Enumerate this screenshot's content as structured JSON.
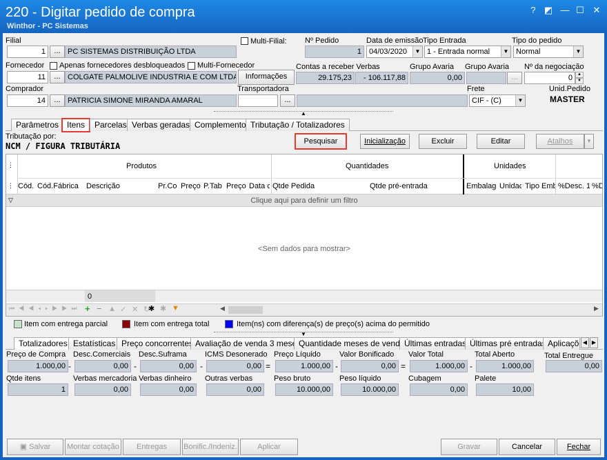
{
  "window": {
    "title": "220 - Digitar pedido de compra",
    "subtitle": "Winthor - PC Sistemas"
  },
  "header": {
    "filial_label": "Filial",
    "filial_value": "1",
    "filial_name": "PC SISTEMAS DISTRIBUIÇÃO LTDA",
    "multi_filial": "Multi-Filial:",
    "num_pedido_label": "Nº Pedido",
    "num_pedido_value": "1",
    "data_emissao_label": "Data de emissão",
    "data_emissao_value": "04/03/2020",
    "tipo_entrada_label": "Tipo Entrada",
    "tipo_entrada_value": "1 - Entrada normal",
    "tipo_pedido_label": "Tipo do pedido",
    "tipo_pedido_value": "Normal",
    "fornecedor_label": "Fornecedor",
    "fornecedores_desbloq": "Apenas fornecedores desbloqueados",
    "multi_fornecedor": "Multi-Fornecedor",
    "fornecedor_value": "11",
    "fornecedor_name": "COLGATE PALMOLIVE INDUSTRIA  E COM LTDA",
    "informacoes": "Informações",
    "contas_label": "Contas a receber Verbas",
    "contas_value1": "29.175,23",
    "contas_value2": "- 106.117,88",
    "grupo_avaria_label": "Grupo Avaria",
    "grupo_avaria_value": "0,00",
    "grupo_avaria2_label": "Grupo Avaria",
    "num_negociacao_label": "Nº da negociação",
    "num_negociacao_value": "0",
    "comprador_label": "Comprador",
    "comprador_value": "14",
    "comprador_name": "PATRICIA SIMONE MIRANDA AMARAL",
    "transportadora_label": "Transportadora",
    "frete_label": "Frete",
    "frete_value": "CIF - (C)",
    "unid_pedido_label": "Unid.Pedido",
    "unid_pedido_value": "MASTER",
    "ellipsis": "...",
    "spin_up": "▲",
    "spin_down": "▼"
  },
  "tabs": [
    "Parâmetros",
    "Itens",
    "Parcelas",
    "Verbas geradas",
    "Complemento",
    "Tributação / Totalizadores"
  ],
  "toolbar": {
    "tributacao_label": "Tributação por:",
    "tributacao_value": "NCM / FIGURA TRIBUTÁRIA",
    "pesquisar": "Pesquisar",
    "inicializacao": "Inicialização",
    "excluir": "Excluir",
    "editar": "Editar",
    "atalhos": "Atalhos"
  },
  "grid": {
    "band_produtos": "Produtos",
    "band_quantidades": "Quantidades",
    "band_unidades": "Unidades",
    "columns": [
      "Cód.",
      "Cód.Fábrica",
      "Descrição",
      "Pr.Co",
      "Preço",
      "P.Tab",
      "Preço",
      "Data c",
      "Qtde Pedida",
      "Qtde pré-entrada",
      "Embalage",
      "Unidac",
      "Tipo Emb",
      "%Desc. 1",
      "%D"
    ],
    "filter_text": "Clique aqui para definir um filtro",
    "empty_text": "<Sem dados para mostrar>",
    "footer_count": "0"
  },
  "legend": [
    "Item com entrega parcial",
    "Item com entrega total",
    "Item(ns) com diferença(s) de preço(s) acima do permitido"
  ],
  "legend_colors": [
    "#c8e0c8",
    "#8b0000",
    "#0000ff"
  ],
  "bottom_tabs": [
    "Totalizadores",
    "Estatísticas",
    "Preço concorrentes",
    "Avaliação de venda 3 meses",
    "Quantidade meses de venda",
    "Últimas entradas",
    "Últimas pré entradas",
    "Aplicaçõe"
  ],
  "totals_row1": [
    {
      "label": "Preço de Compra",
      "value": "1.000,00"
    },
    {
      "label": "Desc.Comerciais",
      "value": "0,00"
    },
    {
      "label": "Desc.Suframa",
      "value": "0,00"
    },
    {
      "label": "ICMS Desonerado",
      "value": "0,00"
    },
    {
      "label": "Preço Líquido",
      "value": "1.000,00"
    },
    {
      "label": "Valor Bonificado",
      "value": "0,00"
    },
    {
      "label": "Valor Total",
      "value": "1.000,00"
    },
    {
      "label": "Total Aberto",
      "value": "1.000,00"
    },
    {
      "label": "Total Entregue",
      "value": "0,00"
    }
  ],
  "totals_ops": [
    "-",
    "-",
    "-",
    "=",
    "-",
    "=",
    "-"
  ],
  "totals_row2": [
    {
      "label": "Qtde itens",
      "value": "1"
    },
    {
      "label": "Verbas mercadoria",
      "value": "0,00"
    },
    {
      "label": "Verbas dinheiro",
      "value": "0,00"
    },
    {
      "label": "Outras verbas",
      "value": "0,00"
    },
    {
      "label": "Peso bruto",
      "value": "10.000,00"
    },
    {
      "label": "Peso líquido",
      "value": "10.000,00"
    },
    {
      "label": "Cubagem",
      "value": "0,00"
    },
    {
      "label": "Palete",
      "value": "10,00"
    }
  ],
  "footer": {
    "salvar": "Salvar",
    "montar": "Montar cotação",
    "entregas": "Entregas",
    "bonific": "Bonific./Indeniz.",
    "aplicar": "Aplicar",
    "gravar": "Gravar",
    "cancelar": "Cancelar",
    "fechar": "Fechar"
  }
}
